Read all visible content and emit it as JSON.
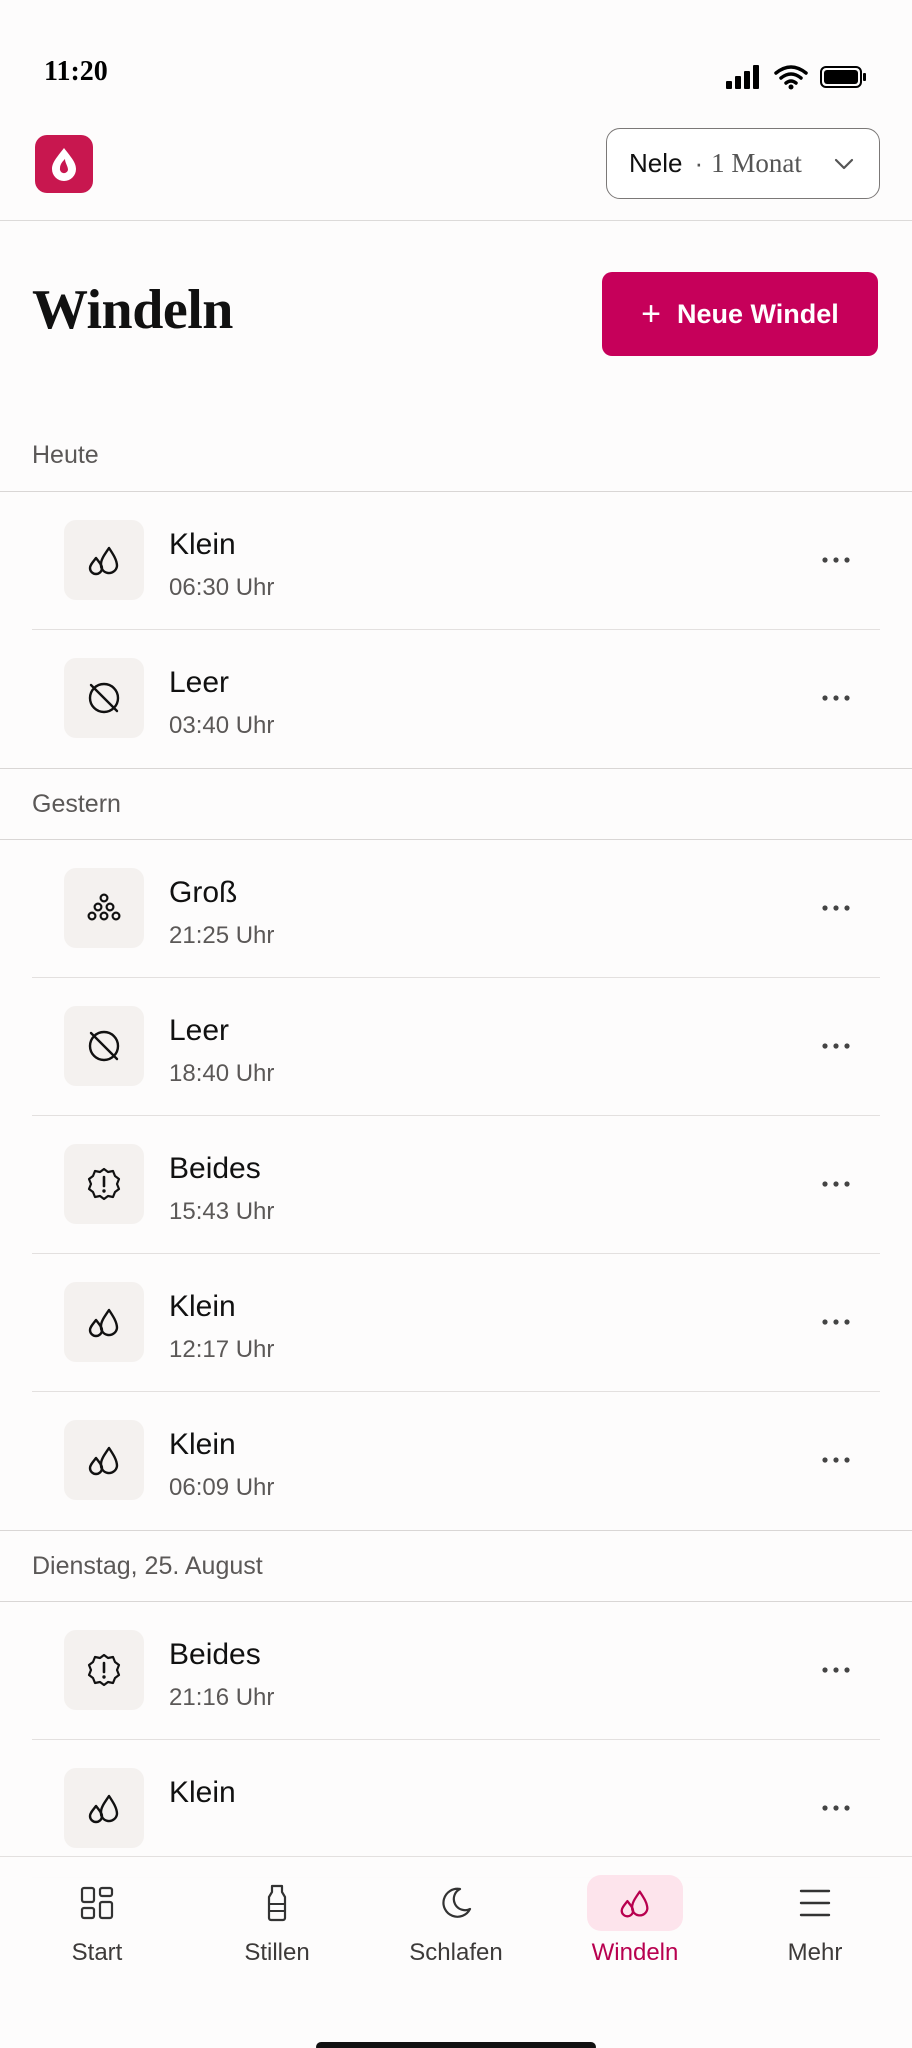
{
  "status_bar": {
    "time": "11:20"
  },
  "app_bar": {
    "child_name": "Nele",
    "separator": "·",
    "child_age": "1 Monat"
  },
  "header": {
    "title": "Windeln",
    "new_button_plus": "+",
    "new_button_label": "Neue Windel"
  },
  "sections": [
    {
      "label": "Heute",
      "entries": [
        {
          "type": "Klein",
          "time": "06:30 Uhr",
          "icon": "droplets-icon"
        },
        {
          "type": "Leer",
          "time": "03:40 Uhr",
          "icon": "empty-circle-icon"
        }
      ]
    },
    {
      "label": "Gestern",
      "entries": [
        {
          "type": "Groß",
          "time": "21:25 Uhr",
          "icon": "dots-pyramid-icon"
        },
        {
          "type": "Leer",
          "time": "18:40 Uhr",
          "icon": "empty-circle-icon"
        },
        {
          "type": "Beides",
          "time": "15:43 Uhr",
          "icon": "alert-badge-icon"
        },
        {
          "type": "Klein",
          "time": "12:17 Uhr",
          "icon": "droplets-icon"
        },
        {
          "type": "Klein",
          "time": "06:09 Uhr",
          "icon": "droplets-icon"
        }
      ]
    },
    {
      "label": "Dienstag, 25. August",
      "entries": [
        {
          "type": "Beides",
          "time": "21:16 Uhr",
          "icon": "alert-badge-icon"
        },
        {
          "type": "Klein",
          "time": "",
          "icon": "droplets-icon"
        }
      ]
    }
  ],
  "bottom_nav": [
    {
      "label": "Start",
      "icon": "grid-icon",
      "active": false
    },
    {
      "label": "Stillen",
      "icon": "bottle-icon",
      "active": false
    },
    {
      "label": "Schlafen",
      "icon": "moon-icon",
      "active": false
    },
    {
      "label": "Windeln",
      "icon": "droplets-icon",
      "active": true
    },
    {
      "label": "Mehr",
      "icon": "menu-icon",
      "active": false
    }
  ],
  "colors": {
    "brand": "#c6005a",
    "logo": "#c8174f",
    "active_nav_bg": "#fde4ec",
    "active_nav_text": "#b8004f"
  }
}
